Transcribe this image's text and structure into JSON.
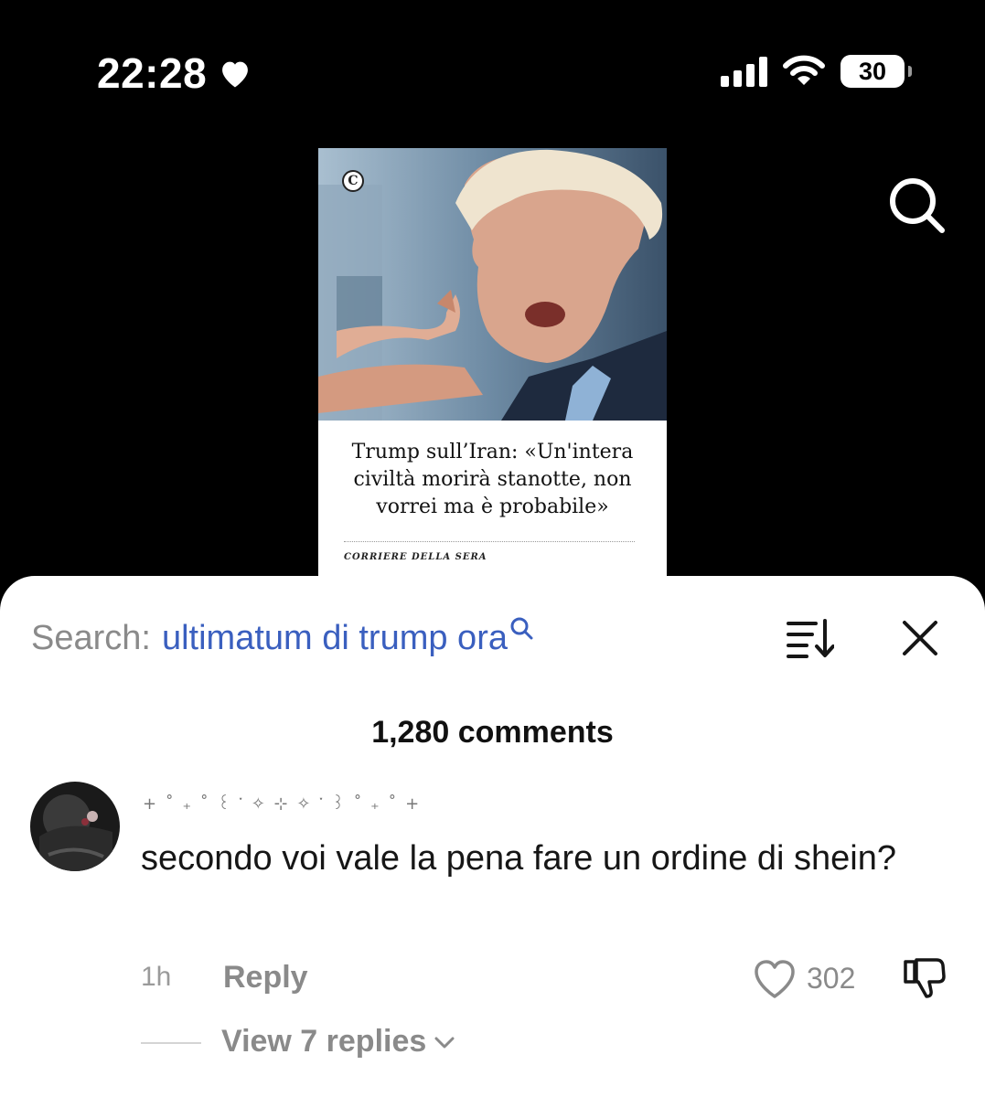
{
  "status": {
    "time": "22:28",
    "battery": "30",
    "heart_icon": "heart-icon",
    "signal_icon": "cellular-signal-icon",
    "wifi_icon": "wifi-icon"
  },
  "card": {
    "logo_letter": "C",
    "headline": "Trump sull’Iran: «Un'intera civiltà morirà stanotte, non vorrei ma è probabile»",
    "brand": "CORRIERE DELLA SERA"
  },
  "comments_sheet": {
    "search_label": "Search:",
    "search_query": "ultimatum di trump ora",
    "comment_count": "1,280 comments",
    "comment": {
      "username": "+ ˚ ₊ ˚ ꒰ ་ ✧ ⊹ ✧ ་ ꒱ ˚ ₊ ˚ +",
      "text": "secondo voi vale la pena fare un ordine di shein?",
      "time_ago": "1h",
      "reply_label": "Reply",
      "likes": "302",
      "view_replies": "View 7 replies"
    }
  },
  "colors": {
    "query_blue": "#3a5fbf",
    "muted_gray": "#8a8a8a",
    "background": "#000000"
  }
}
